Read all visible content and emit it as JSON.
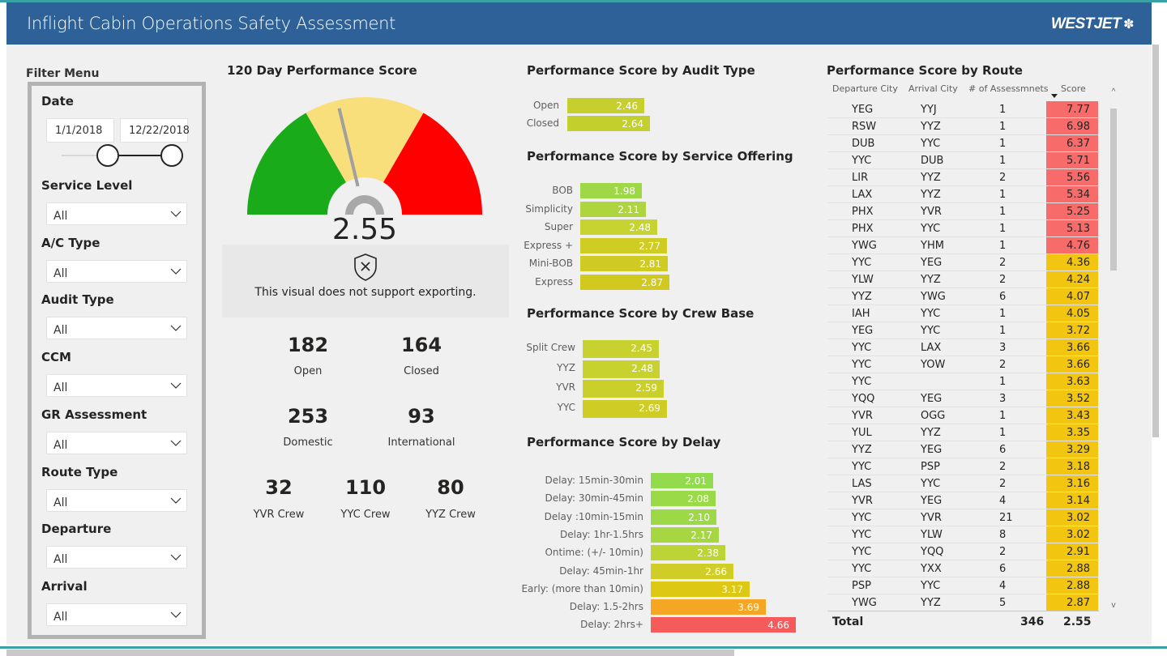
{
  "header": {
    "title": "Inflight Cabin Operations Safety Assessment",
    "logo_text": "WESTJET",
    "logo_icon": "maple-leaf-icon"
  },
  "filter": {
    "menu_label": "Filter Menu",
    "date": {
      "label": "Date",
      "start": "1/1/2018",
      "end": "12/22/2018"
    },
    "dropdowns": [
      {
        "label": "Service Level",
        "value": "All"
      },
      {
        "label": "A/C Type",
        "value": "All"
      },
      {
        "label": "Audit Type",
        "value": "All"
      },
      {
        "label": "CCM",
        "value": "All"
      },
      {
        "label": "GR Assessment",
        "value": "All"
      },
      {
        "label": "Route Type",
        "value": "All"
      },
      {
        "label": "Departure",
        "value": "All"
      },
      {
        "label": "Arrival",
        "value": "All"
      }
    ]
  },
  "gauge": {
    "title": "120 Day Performance Score",
    "value": "2.55",
    "value_num": 2.55,
    "min": 0,
    "max": 6,
    "bands": [
      {
        "from": 0,
        "to": 2,
        "color": "#1aab1a"
      },
      {
        "from": 2,
        "to": 4,
        "color": "#f8df7b"
      },
      {
        "from": 4,
        "to": 6,
        "color": "#ff0000"
      }
    ],
    "export_message": "This visual does not support exporting."
  },
  "kpis": {
    "open": {
      "value": "182",
      "label": "Open"
    },
    "closed": {
      "value": "164",
      "label": "Closed"
    },
    "domestic": {
      "value": "253",
      "label": "Domestic"
    },
    "international": {
      "value": "93",
      "label": "International"
    },
    "yvr": {
      "value": "32",
      "label": "YVR Crew"
    },
    "yyc": {
      "value": "110",
      "label": "YYC Crew"
    },
    "yyz": {
      "value": "80",
      "label": "YYZ Crew"
    }
  },
  "chart_data": [
    {
      "type": "bar",
      "title": "Performance Score by Audit Type",
      "categories": [
        "Open",
        "Closed"
      ],
      "values": [
        2.46,
        2.64
      ],
      "labels": [
        "2.46",
        "2.64"
      ],
      "colors": [
        "#c7cf2f",
        "#c3cf2c"
      ]
    },
    {
      "type": "bar",
      "title": "Performance Score by Service Offering",
      "categories": [
        "BOB",
        "Simplicity",
        "Super",
        "Express +",
        "Mini-BOB",
        "Express"
      ],
      "values": [
        1.98,
        2.11,
        2.48,
        2.77,
        2.81,
        2.87
      ],
      "labels": [
        "1.98",
        "2.11",
        "2.48",
        "2.77",
        "2.81",
        "2.87"
      ],
      "colors": [
        "#9fd847",
        "#aed43e",
        "#c6d330",
        "#cfcd24",
        "#d0cb22",
        "#d1c91f"
      ]
    },
    {
      "type": "bar",
      "title": "Performance Score by Crew Base",
      "categories": [
        "Split Crew",
        "YYZ",
        "YVR",
        "YYC"
      ],
      "values": [
        2.45,
        2.48,
        2.59,
        2.69
      ],
      "labels": [
        "2.45",
        "2.48",
        "2.59",
        "2.69"
      ],
      "colors": [
        "#c7d231",
        "#c8d22f",
        "#cbcf2a",
        "#cfcc25"
      ]
    },
    {
      "type": "bar",
      "title": "Performance Score by Delay",
      "categories": [
        "Delay: 15min-30min",
        "Delay: 30min-45min",
        "Delay :10min-15min",
        "Delay: 1hr-1.5hrs",
        "Ontime: (+/- 10min)",
        "Delay: 45min-1hr",
        "Early: (more than 10min)",
        "Delay: 1.5-2hrs",
        "Delay: 2hrs+"
      ],
      "values": [
        2.01,
        2.08,
        2.1,
        2.17,
        2.38,
        2.66,
        3.17,
        3.69,
        4.66
      ],
      "labels": [
        "2.01",
        "2.08",
        "2.10",
        "2.17",
        "2.38",
        "2.66",
        "3.17",
        "3.69",
        "4.66"
      ],
      "colors": [
        "#92db4c",
        "#9ad948",
        "#9dd946",
        "#a6d742",
        "#bcd436",
        "#d0ce26",
        "#ddc814",
        "#f5a623",
        "#f55b5b"
      ]
    },
    {
      "type": "table",
      "title": "Performance Score by Route",
      "columns": [
        "Departure City",
        "Arrival City",
        "# of Assessmnets",
        "Score"
      ],
      "rows": [
        [
          "YEG",
          "YYJ",
          "1",
          "7.77",
          "#f86b6b"
        ],
        [
          "RSW",
          "YYZ",
          "1",
          "6.98",
          "#f86b6b"
        ],
        [
          "DUB",
          "YYC",
          "1",
          "6.37",
          "#f86b6b"
        ],
        [
          "YYC",
          "DUB",
          "1",
          "5.71",
          "#f86b6b"
        ],
        [
          "LIR",
          "YYZ",
          "2",
          "5.56",
          "#f86b6b"
        ],
        [
          "LAX",
          "YYZ",
          "1",
          "5.34",
          "#f86b6b"
        ],
        [
          "PHX",
          "YVR",
          "1",
          "5.25",
          "#f86b6b"
        ],
        [
          "PHX",
          "YYC",
          "1",
          "5.13",
          "#f86b6b"
        ],
        [
          "YWG",
          "YHM",
          "1",
          "4.76",
          "#f86b6b"
        ],
        [
          "YYC",
          "YEG",
          "2",
          "4.36",
          "#f2c511"
        ],
        [
          "YLW",
          "YYZ",
          "2",
          "4.24",
          "#f2c511"
        ],
        [
          "YYZ",
          "YWG",
          "6",
          "4.07",
          "#f2c511"
        ],
        [
          "IAH",
          "YYC",
          "1",
          "4.05",
          "#f2c511"
        ],
        [
          "YEG",
          "YYC",
          "1",
          "3.72",
          "#f2c511"
        ],
        [
          "YYC",
          "LAX",
          "3",
          "3.66",
          "#f2c511"
        ],
        [
          "YYC",
          "YOW",
          "2",
          "3.66",
          "#f2c511"
        ],
        [
          "YYC",
          "",
          "1",
          "3.63",
          "#f2c511"
        ],
        [
          "YQQ",
          "YEG",
          "3",
          "3.52",
          "#f2c511"
        ],
        [
          "YVR",
          "OGG",
          "1",
          "3.43",
          "#f2c511"
        ],
        [
          "YUL",
          "YYZ",
          "1",
          "3.35",
          "#f2c511"
        ],
        [
          "YYZ",
          "YEG",
          "6",
          "3.29",
          "#f2c511"
        ],
        [
          "YYC",
          "PSP",
          "2",
          "3.18",
          "#f2c511"
        ],
        [
          "LAS",
          "YYC",
          "2",
          "3.16",
          "#f2c511"
        ],
        [
          "YVR",
          "YEG",
          "4",
          "3.14",
          "#f2c511"
        ],
        [
          "YYC",
          "YVR",
          "21",
          "3.02",
          "#f2c511"
        ],
        [
          "YYC",
          "YLW",
          "8",
          "3.02",
          "#f2c511"
        ],
        [
          "YYC",
          "YQQ",
          "2",
          "2.91",
          "#f2c511"
        ],
        [
          "YYC",
          "YXX",
          "6",
          "2.88",
          "#f2c511"
        ],
        [
          "PSP",
          "YYC",
          "4",
          "2.88",
          "#f2c511"
        ],
        [
          "YWG",
          "YYZ",
          "5",
          "2.87",
          "#f2c511"
        ]
      ],
      "total": {
        "label": "Total",
        "count": "346",
        "score": "2.55"
      }
    }
  ]
}
